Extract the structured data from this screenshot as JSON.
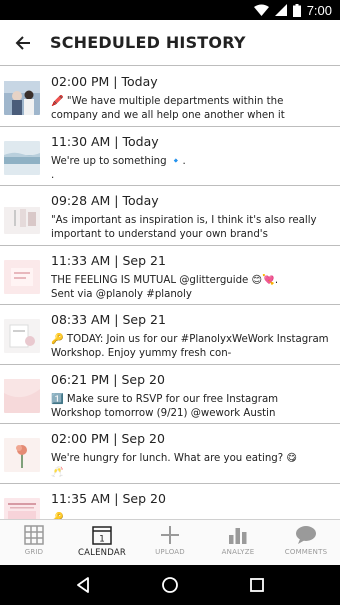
{
  "status_bar": {
    "time": "7:00"
  },
  "header": {
    "title": "SCHEDULED HISTORY"
  },
  "posts": [
    {
      "time": "02:00 PM | Today",
      "caption": "🖍️ \"We have multiple departments within the company and we all help one another when it",
      "thumb": "thumb-1"
    },
    {
      "time": "11:30 AM | Today",
      "caption": "We're up to something 🔹.\n.",
      "thumb": "thumb-2"
    },
    {
      "time": "09:28 AM | Today",
      "caption": "\"As important as inspiration is, I think it's also really important to understand your own brand's",
      "thumb": "thumb-3"
    },
    {
      "time": "11:33 AM | Sep 21",
      "caption": "THE FEELING IS MUTUAL @glitterguide 😊💘.\nSent via @planoly #planoly",
      "thumb": "thumb-4"
    },
    {
      "time": "08:33 AM | Sep 21",
      "caption": "🔑 TODAY: Join us for our #PlanolyxWeWork Instagram Workshop. Enjoy yummy fresh con-",
      "thumb": "thumb-5"
    },
    {
      "time": "06:21 PM | Sep 20",
      "caption": "1️⃣ Make sure to RSVP for our free Instagram Workshop tomorrow (9/21) @wework Austin",
      "thumb": "thumb-6"
    },
    {
      "time": "02:00 PM | Sep 20",
      "caption": "We're hungry for lunch. What are you eating? 😋\n🥂",
      "thumb": "thumb-7"
    },
    {
      "time": "11:35 AM | Sep 20",
      "caption": "🔑",
      "thumb": "thumb-8"
    }
  ],
  "tabs": [
    {
      "label": "GRID",
      "icon": "grid-icon"
    },
    {
      "label": "CALENDAR",
      "icon": "calendar-icon",
      "badge": "1",
      "active": true
    },
    {
      "label": "UPLOAD",
      "icon": "plus-icon"
    },
    {
      "label": "ANALYZE",
      "icon": "bar-chart-icon"
    },
    {
      "label": "COMMENTS",
      "icon": "speech-bubble-icon"
    }
  ],
  "colors": {
    "accent": "#222222",
    "inactive": "#9a9a9a",
    "divider": "#bdbdbd"
  }
}
